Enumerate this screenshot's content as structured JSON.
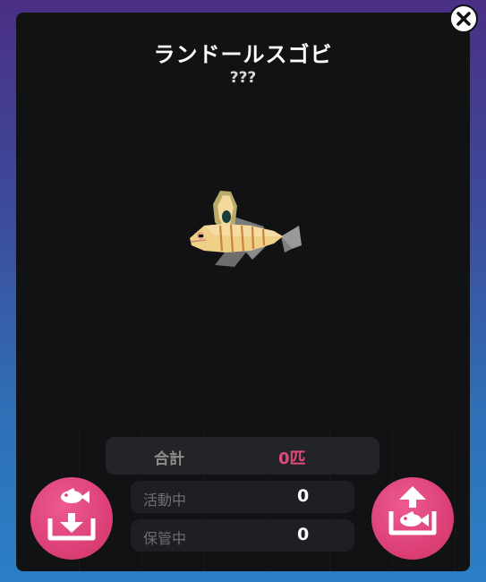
{
  "fish": {
    "name": "ランドールスゴビ",
    "subtitle": "???"
  },
  "stats": {
    "total_label": "合計",
    "total_value": "0匹",
    "active_label": "活動中",
    "active_value": "0",
    "storage_label": "保管中",
    "storage_value": "0"
  },
  "icons": {
    "close": "close-icon",
    "store": "fish-store-icon",
    "release": "fish-release-icon"
  },
  "colors": {
    "accent_pink": "#e2487c",
    "button_pink": "#d93d74",
    "panel": "#111214"
  }
}
